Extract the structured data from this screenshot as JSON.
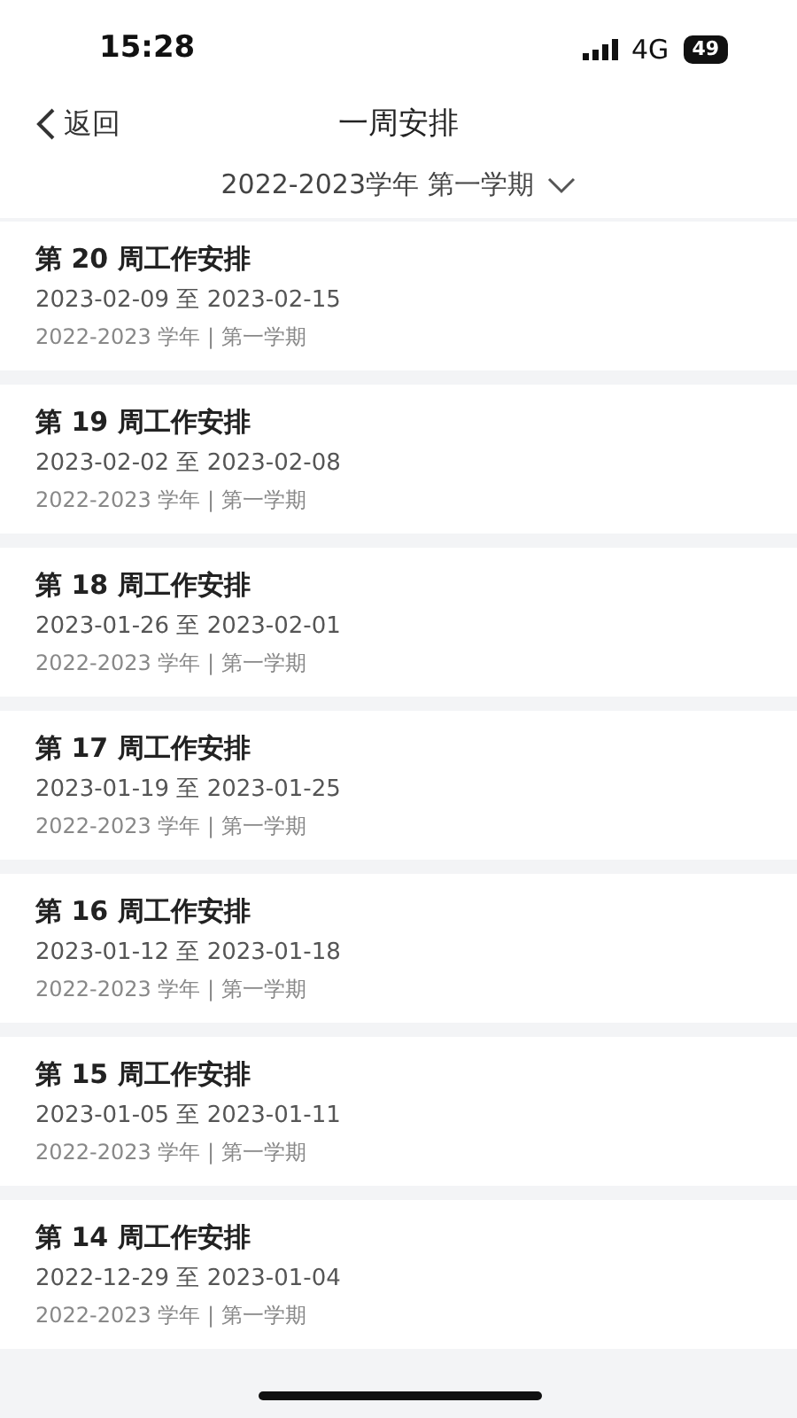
{
  "status_bar": {
    "time": "15:28",
    "network": "4G",
    "battery": "49"
  },
  "nav": {
    "back": "返回",
    "title": "一周安排"
  },
  "filter": {
    "label": "2022-2023学年 第一学期"
  },
  "weeks": [
    {
      "title": "第 20 周工作安排",
      "dates": "2023-02-09 至 2023-02-15",
      "term": "2022-2023 学年 | 第一学期"
    },
    {
      "title": "第 19 周工作安排",
      "dates": "2023-02-02 至 2023-02-08",
      "term": "2022-2023 学年 | 第一学期"
    },
    {
      "title": "第 18 周工作安排",
      "dates": "2023-01-26 至 2023-02-01",
      "term": "2022-2023 学年 | 第一学期"
    },
    {
      "title": "第 17 周工作安排",
      "dates": "2023-01-19 至 2023-01-25",
      "term": "2022-2023 学年 | 第一学期"
    },
    {
      "title": "第 16 周工作安排",
      "dates": "2023-01-12 至 2023-01-18",
      "term": "2022-2023 学年 | 第一学期"
    },
    {
      "title": "第 15 周工作安排",
      "dates": "2023-01-05 至 2023-01-11",
      "term": "2022-2023 学年 | 第一学期"
    },
    {
      "title": "第 14 周工作安排",
      "dates": "2022-12-29 至 2023-01-04",
      "term": "2022-2023 学年 | 第一学期"
    }
  ]
}
